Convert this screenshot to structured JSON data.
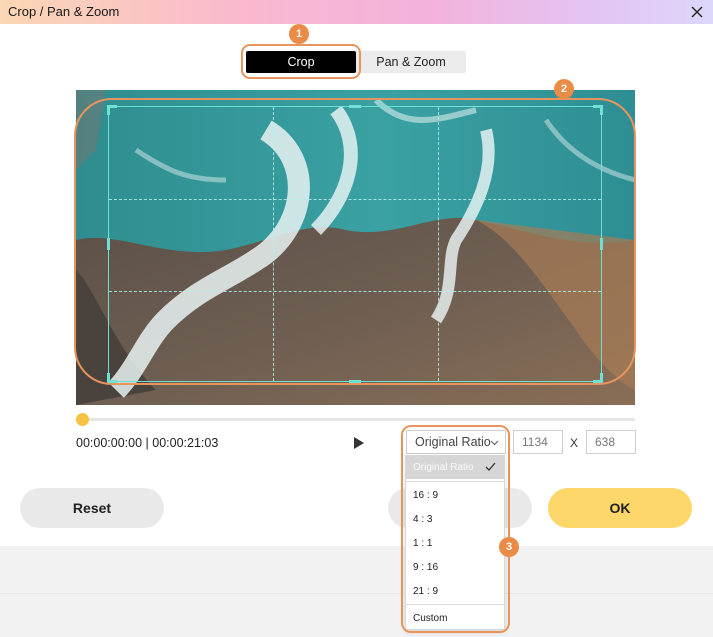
{
  "window": {
    "title": "Crop / Pan & Zoom"
  },
  "tabs": [
    {
      "label": "Crop",
      "active": true
    },
    {
      "label": "Pan & Zoom",
      "active": false
    }
  ],
  "annotations": {
    "badge1": "1",
    "badge2": "2",
    "badge3": "3",
    "color": "#ea8b47"
  },
  "playback": {
    "current_time": "00:00:00:00",
    "separator": "|",
    "duration": "00:00:21:03",
    "progress": 0.0
  },
  "crop": {
    "ratio_selected": "Original Ratio",
    "width": "1134",
    "height": "638",
    "dim_separator": "X",
    "ratio_options": [
      "Original Ratio",
      "16 : 9",
      "4 : 3",
      "1 : 1",
      "9 : 16",
      "21 : 9",
      "Custom"
    ]
  },
  "buttons": {
    "reset": "Reset",
    "ok": "OK"
  },
  "colors": {
    "accent_yellow": "#fdd76a",
    "crop_frame": "#6fe0d4",
    "tab_active": "#000000"
  }
}
